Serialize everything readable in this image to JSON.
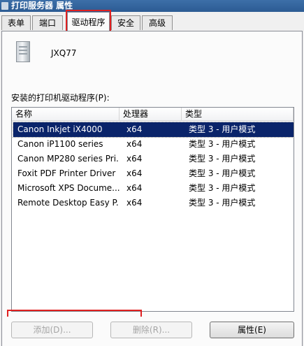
{
  "window": {
    "title": "打印服务器 属性"
  },
  "tabs": [
    {
      "label": "表单"
    },
    {
      "label": "端口"
    },
    {
      "label": "驱动程序"
    },
    {
      "label": "安全"
    },
    {
      "label": "高级"
    }
  ],
  "server": {
    "name": "JXQ77",
    "icon": "server-icon"
  },
  "drivers": {
    "label": "安装的打印机驱动程序(P):",
    "columns": [
      "名称",
      "处理器",
      "类型"
    ],
    "rows": [
      [
        "Canon Inkjet iX4000",
        "x64",
        "类型 3 - 用户模式"
      ],
      [
        "Canon iP1100 series",
        "x64",
        "类型 3 - 用户模式"
      ],
      [
        "Canon MP280 series Pri...",
        "x64",
        "类型 3 - 用户模式"
      ],
      [
        "Foxit PDF Printer Driver",
        "x64",
        "类型 3 - 用户模式"
      ],
      [
        "Microsoft XPS Docume...",
        "x64",
        "类型 3 - 用户模式"
      ],
      [
        "Remote Desktop Easy P...",
        "x64",
        "类型 3 - 用户模式"
      ]
    ],
    "selected_index": 0
  },
  "buttons": {
    "add": "添加(D)...",
    "remove": "删除(R)...",
    "properties": "属性(E)"
  },
  "colors": {
    "highlight": "#e02020",
    "selection": "#0a246a",
    "titlebar": "#2c5b93"
  }
}
